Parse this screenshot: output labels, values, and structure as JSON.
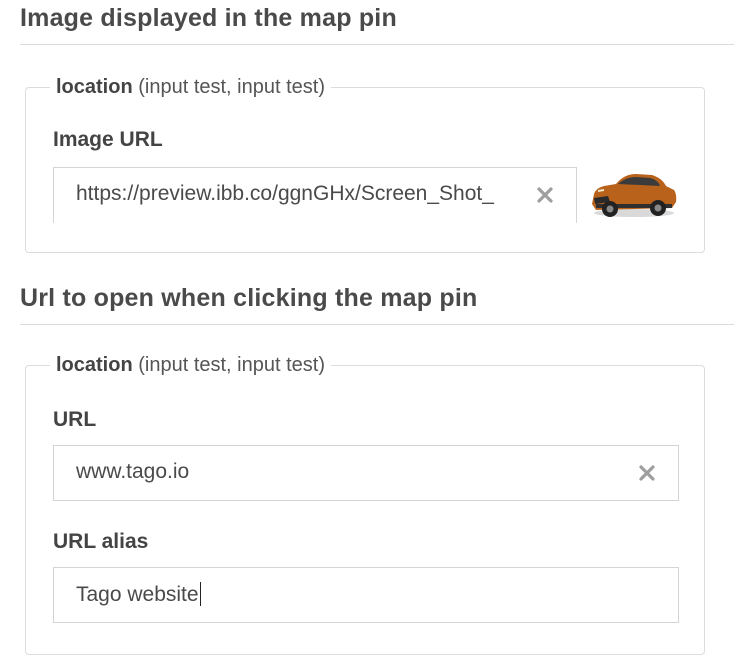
{
  "image_section": {
    "heading": "Image displayed in the map pin",
    "legend_title": "location",
    "legend_sub": "(input test, input test)",
    "image_url_label": "Image URL",
    "image_url_value": "https://preview.ibb.co/ggnGHx/Screen_Shot_",
    "thumbnail_alt": "car image preview"
  },
  "url_section": {
    "heading": "Url to open when clicking the map pin",
    "legend_title": "location",
    "legend_sub": "(input test, input test)",
    "url_label": "URL",
    "url_value": "www.tago.io",
    "alias_label": "URL alias",
    "alias_value": "Tago website"
  },
  "icons": {
    "clear": "close-icon",
    "thumbnail": "car-thumbnail"
  },
  "colors": {
    "text": "#4a4a4a",
    "border": "#dcdcdc",
    "clear_icon": "#9e9e9e",
    "car_body": "#b8621b"
  }
}
